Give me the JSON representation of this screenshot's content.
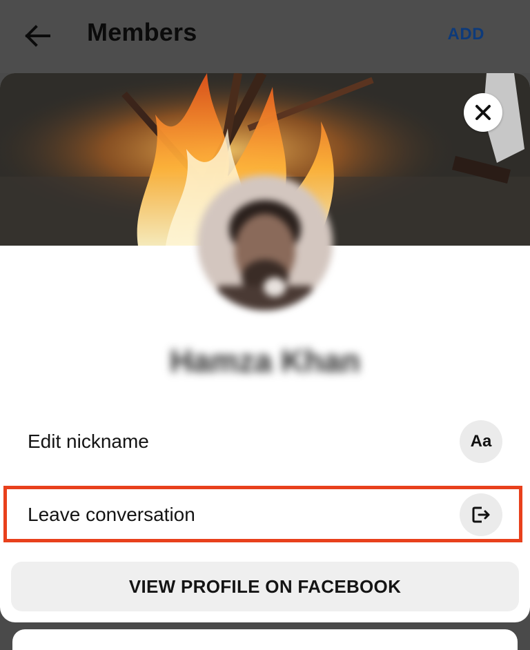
{
  "appbar": {
    "title": "Members",
    "add_label": "ADD",
    "back_icon": "arrow-left-icon"
  },
  "profile_sheet": {
    "cover_photo": "bonfire-photo",
    "close_icon": "close-icon",
    "name": "Hamza Khan",
    "actions": [
      {
        "label": "Edit nickname",
        "icon": "Aa"
      },
      {
        "label": "Leave conversation",
        "icon": "exit-icon"
      }
    ],
    "view_profile_label": "VIEW PROFILE ON FACEBOOK"
  },
  "colors": {
    "highlight": "#e8401c",
    "accent": "#0d3a7a"
  }
}
